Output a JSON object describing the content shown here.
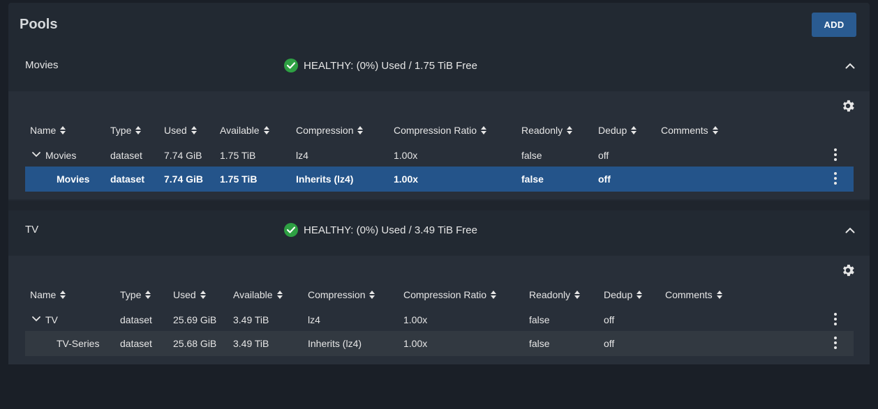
{
  "page": {
    "title": "Pools",
    "add_label": "ADD"
  },
  "colors": {
    "accent": "#2a5b91",
    "healthy": "#2ea043",
    "selected_row": "#24548a"
  },
  "pools": [
    {
      "name": "Movies",
      "status": "HEALTHY: (0%) Used / 1.75 TiB Free",
      "columns": [
        "Name",
        "Type",
        "Used",
        "Available",
        "Compression",
        "Compression Ratio",
        "Readonly",
        "Dedup",
        "Comments"
      ],
      "rows": [
        {
          "name": "Movies",
          "type": "dataset",
          "used": "7.74 GiB",
          "available": "1.75 TiB",
          "compression": "lz4",
          "ratio": "1.00x",
          "readonly": "false",
          "dedup": "off",
          "comments": ""
        },
        {
          "name": "Movies",
          "type": "dataset",
          "used": "7.74 GiB",
          "available": "1.75 TiB",
          "compression": "Inherits (lz4)",
          "ratio": "1.00x",
          "readonly": "false",
          "dedup": "off",
          "comments": ""
        }
      ]
    },
    {
      "name": "TV",
      "status": "HEALTHY: (0%) Used / 3.49 TiB Free",
      "columns": [
        "Name",
        "Type",
        "Used",
        "Available",
        "Compression",
        "Compression Ratio",
        "Readonly",
        "Dedup",
        "Comments"
      ],
      "rows": [
        {
          "name": "TV",
          "type": "dataset",
          "used": "25.69 GiB",
          "available": "3.49 TiB",
          "compression": "lz4",
          "ratio": "1.00x",
          "readonly": "false",
          "dedup": "off",
          "comments": ""
        },
        {
          "name": "TV-Series",
          "type": "dataset",
          "used": "25.68 GiB",
          "available": "3.49 TiB",
          "compression": "Inherits (lz4)",
          "ratio": "1.00x",
          "readonly": "false",
          "dedup": "off",
          "comments": ""
        }
      ]
    }
  ]
}
